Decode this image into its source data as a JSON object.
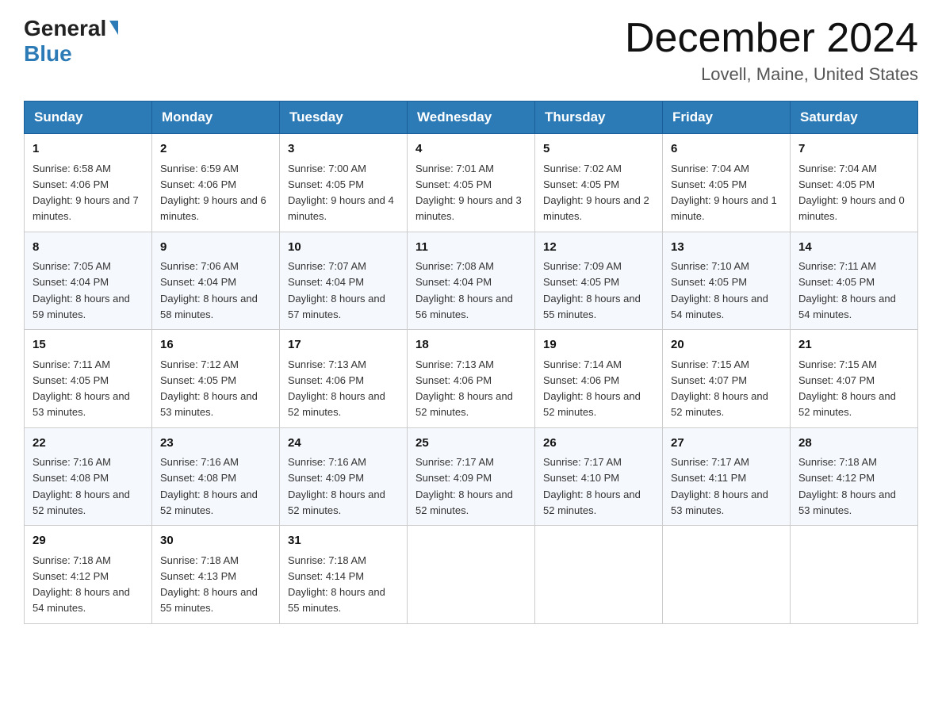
{
  "header": {
    "logo_general": "General",
    "logo_blue": "Blue",
    "month_title": "December 2024",
    "location": "Lovell, Maine, United States"
  },
  "days_of_week": [
    "Sunday",
    "Monday",
    "Tuesday",
    "Wednesday",
    "Thursday",
    "Friday",
    "Saturday"
  ],
  "weeks": [
    [
      {
        "day": "1",
        "sunrise": "6:58 AM",
        "sunset": "4:06 PM",
        "daylight": "9 hours and 7 minutes."
      },
      {
        "day": "2",
        "sunrise": "6:59 AM",
        "sunset": "4:06 PM",
        "daylight": "9 hours and 6 minutes."
      },
      {
        "day": "3",
        "sunrise": "7:00 AM",
        "sunset": "4:05 PM",
        "daylight": "9 hours and 4 minutes."
      },
      {
        "day": "4",
        "sunrise": "7:01 AM",
        "sunset": "4:05 PM",
        "daylight": "9 hours and 3 minutes."
      },
      {
        "day": "5",
        "sunrise": "7:02 AM",
        "sunset": "4:05 PM",
        "daylight": "9 hours and 2 minutes."
      },
      {
        "day": "6",
        "sunrise": "7:04 AM",
        "sunset": "4:05 PM",
        "daylight": "9 hours and 1 minute."
      },
      {
        "day": "7",
        "sunrise": "7:04 AM",
        "sunset": "4:05 PM",
        "daylight": "9 hours and 0 minutes."
      }
    ],
    [
      {
        "day": "8",
        "sunrise": "7:05 AM",
        "sunset": "4:04 PM",
        "daylight": "8 hours and 59 minutes."
      },
      {
        "day": "9",
        "sunrise": "7:06 AM",
        "sunset": "4:04 PM",
        "daylight": "8 hours and 58 minutes."
      },
      {
        "day": "10",
        "sunrise": "7:07 AM",
        "sunset": "4:04 PM",
        "daylight": "8 hours and 57 minutes."
      },
      {
        "day": "11",
        "sunrise": "7:08 AM",
        "sunset": "4:04 PM",
        "daylight": "8 hours and 56 minutes."
      },
      {
        "day": "12",
        "sunrise": "7:09 AM",
        "sunset": "4:05 PM",
        "daylight": "8 hours and 55 minutes."
      },
      {
        "day": "13",
        "sunrise": "7:10 AM",
        "sunset": "4:05 PM",
        "daylight": "8 hours and 54 minutes."
      },
      {
        "day": "14",
        "sunrise": "7:11 AM",
        "sunset": "4:05 PM",
        "daylight": "8 hours and 54 minutes."
      }
    ],
    [
      {
        "day": "15",
        "sunrise": "7:11 AM",
        "sunset": "4:05 PM",
        "daylight": "8 hours and 53 minutes."
      },
      {
        "day": "16",
        "sunrise": "7:12 AM",
        "sunset": "4:05 PM",
        "daylight": "8 hours and 53 minutes."
      },
      {
        "day": "17",
        "sunrise": "7:13 AM",
        "sunset": "4:06 PM",
        "daylight": "8 hours and 52 minutes."
      },
      {
        "day": "18",
        "sunrise": "7:13 AM",
        "sunset": "4:06 PM",
        "daylight": "8 hours and 52 minutes."
      },
      {
        "day": "19",
        "sunrise": "7:14 AM",
        "sunset": "4:06 PM",
        "daylight": "8 hours and 52 minutes."
      },
      {
        "day": "20",
        "sunrise": "7:15 AM",
        "sunset": "4:07 PM",
        "daylight": "8 hours and 52 minutes."
      },
      {
        "day": "21",
        "sunrise": "7:15 AM",
        "sunset": "4:07 PM",
        "daylight": "8 hours and 52 minutes."
      }
    ],
    [
      {
        "day": "22",
        "sunrise": "7:16 AM",
        "sunset": "4:08 PM",
        "daylight": "8 hours and 52 minutes."
      },
      {
        "day": "23",
        "sunrise": "7:16 AM",
        "sunset": "4:08 PM",
        "daylight": "8 hours and 52 minutes."
      },
      {
        "day": "24",
        "sunrise": "7:16 AM",
        "sunset": "4:09 PM",
        "daylight": "8 hours and 52 minutes."
      },
      {
        "day": "25",
        "sunrise": "7:17 AM",
        "sunset": "4:09 PM",
        "daylight": "8 hours and 52 minutes."
      },
      {
        "day": "26",
        "sunrise": "7:17 AM",
        "sunset": "4:10 PM",
        "daylight": "8 hours and 52 minutes."
      },
      {
        "day": "27",
        "sunrise": "7:17 AM",
        "sunset": "4:11 PM",
        "daylight": "8 hours and 53 minutes."
      },
      {
        "day": "28",
        "sunrise": "7:18 AM",
        "sunset": "4:12 PM",
        "daylight": "8 hours and 53 minutes."
      }
    ],
    [
      {
        "day": "29",
        "sunrise": "7:18 AM",
        "sunset": "4:12 PM",
        "daylight": "8 hours and 54 minutes."
      },
      {
        "day": "30",
        "sunrise": "7:18 AM",
        "sunset": "4:13 PM",
        "daylight": "8 hours and 55 minutes."
      },
      {
        "day": "31",
        "sunrise": "7:18 AM",
        "sunset": "4:14 PM",
        "daylight": "8 hours and 55 minutes."
      },
      null,
      null,
      null,
      null
    ]
  ],
  "labels": {
    "sunrise": "Sunrise:",
    "sunset": "Sunset:",
    "daylight": "Daylight:"
  }
}
